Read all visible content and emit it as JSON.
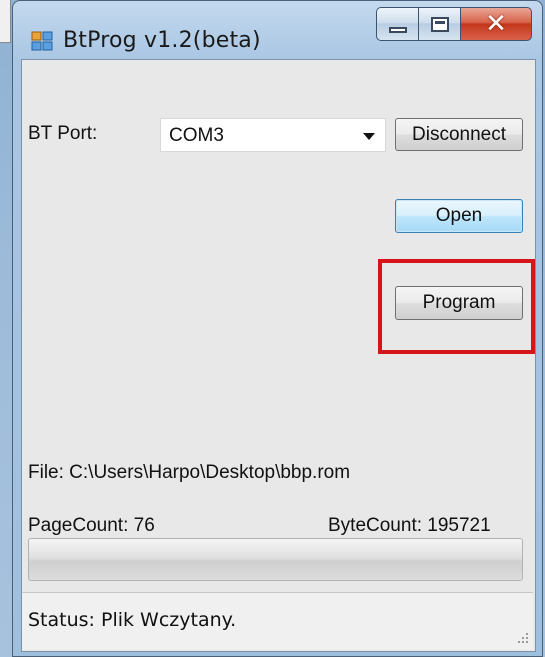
{
  "window": {
    "title": "BtProg v1.2(beta)"
  },
  "connection": {
    "port_label": "BT Port:",
    "port_value": "COM3",
    "disconnect_label": "Disconnect"
  },
  "actions": {
    "open_label": "Open",
    "program_label": "Program"
  },
  "file_info": {
    "file_text": "File: C:\\Users\\Harpo\\Desktop\\bbp.rom",
    "page_count_text": "PageCount: 76",
    "byte_count_text": "ByteCount: 195721"
  },
  "progress": {
    "value_fraction": 0
  },
  "status": {
    "text": "Status: Plik Wczytany."
  },
  "colors": {
    "highlight": "#d7141a",
    "close_button": "#c4371c"
  },
  "icons": {
    "app": "app-window-icon",
    "minimize": "minimize-icon",
    "maximize": "maximize-icon",
    "close": "close-icon",
    "dropdown": "chevron-down-icon",
    "grip": "resize-grip-icon"
  }
}
